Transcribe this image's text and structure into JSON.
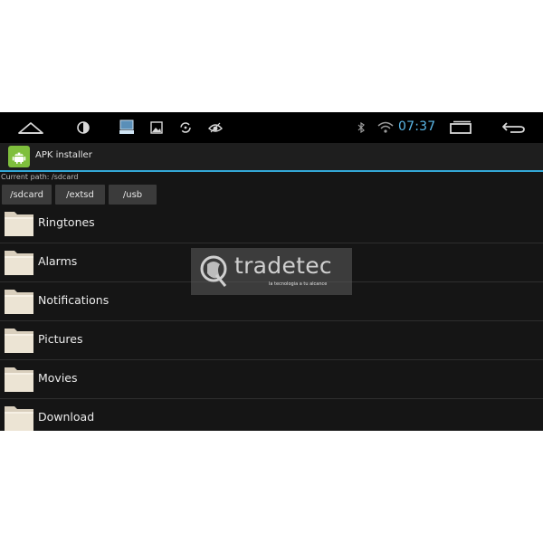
{
  "statusbar": {
    "time": "07:37",
    "icons": [
      "home-icon",
      "brightness-icon",
      "screenshot-icon",
      "gallery-icon",
      "sync-icon",
      "eye-icon",
      "bluetooth-icon",
      "wifi-icon",
      "recent-apps-icon",
      "back-icon"
    ]
  },
  "actionbar": {
    "title": "APK installer"
  },
  "path": {
    "label": "Current path: /sdcard",
    "buttons": [
      "/sdcard",
      "/extsd",
      "/usb"
    ]
  },
  "files": [
    {
      "name": "Ringtones"
    },
    {
      "name": "Alarms"
    },
    {
      "name": "Notifications"
    },
    {
      "name": "Pictures"
    },
    {
      "name": "Movies"
    },
    {
      "name": "Download"
    }
  ],
  "watermark": {
    "brand": "tradetec",
    "tagline": "la tecnologia a tu alcance"
  },
  "colors": {
    "accent": "#33a7d6",
    "clock": "#5bb8e8",
    "background": "#151515",
    "android_green": "#7fbf3d"
  }
}
